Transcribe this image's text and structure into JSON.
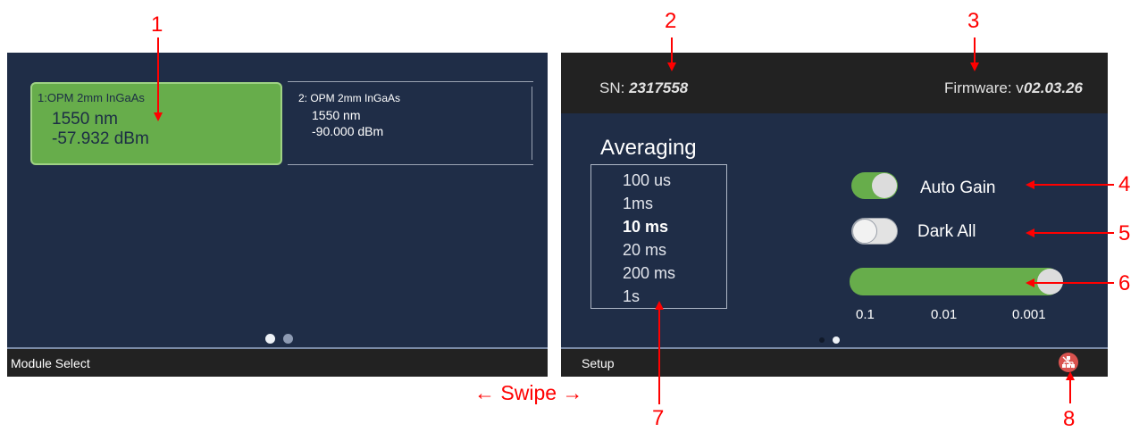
{
  "module_select": {
    "modules": [
      {
        "name": "1:OPM 2mm InGaAs",
        "wavelength": "1550 nm",
        "power": "-57.932 dBm",
        "selected": true
      },
      {
        "name": "2: OPM 2mm InGaAs",
        "wavelength": "1550 nm",
        "power": "-90.000 dBm",
        "selected": false
      }
    ],
    "page_dots": {
      "count": 2,
      "active": 1
    },
    "footer_label": "Module Select"
  },
  "setup": {
    "serial_label": "SN:",
    "serial_value": "2317558",
    "firmware_label": "Firmware: v",
    "firmware_value": "02.03.26",
    "averaging": {
      "title": "Averaging",
      "options": [
        "100 us",
        "1ms",
        "10 ms",
        "20 ms",
        "200 ms",
        "1s"
      ],
      "selected": "10 ms"
    },
    "toggles": [
      {
        "label": "Auto Gain",
        "on": true
      },
      {
        "label": "Dark All",
        "on": false
      }
    ],
    "slider": {
      "ticks": [
        "0.1",
        "0.01",
        "0.001"
      ],
      "value": "0.001"
    },
    "page_dots": {
      "count": 2,
      "active": 2
    },
    "footer_label": "Setup",
    "connection_icon": "connection-status-icon"
  },
  "annotations": {
    "numbers": [
      "1",
      "2",
      "3",
      "4",
      "5",
      "6",
      "7",
      "8"
    ],
    "swipe": "← Swipe →"
  },
  "colors": {
    "screen_bg": "#1f2d47",
    "bar_bg": "#222222",
    "accent_green": "#67ad4b",
    "annotation_red": "#ff0000",
    "connection_red": "#d9534f"
  }
}
